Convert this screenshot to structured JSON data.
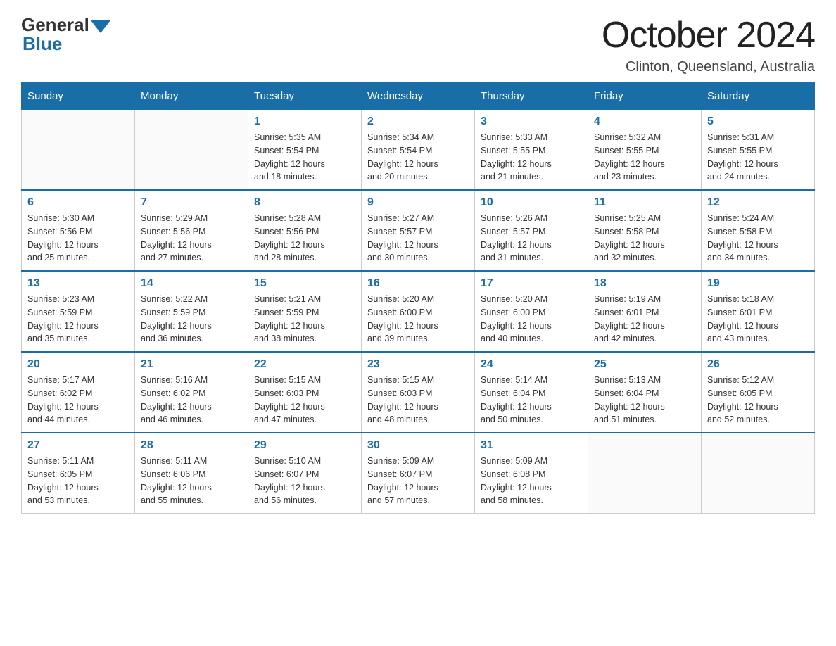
{
  "logo": {
    "general": "General",
    "blue": "Blue"
  },
  "title": "October 2024",
  "subtitle": "Clinton, Queensland, Australia",
  "days_of_week": [
    "Sunday",
    "Monday",
    "Tuesday",
    "Wednesday",
    "Thursday",
    "Friday",
    "Saturday"
  ],
  "weeks": [
    [
      {
        "day": "",
        "info": ""
      },
      {
        "day": "",
        "info": ""
      },
      {
        "day": "1",
        "info": "Sunrise: 5:35 AM\nSunset: 5:54 PM\nDaylight: 12 hours\nand 18 minutes."
      },
      {
        "day": "2",
        "info": "Sunrise: 5:34 AM\nSunset: 5:54 PM\nDaylight: 12 hours\nand 20 minutes."
      },
      {
        "day": "3",
        "info": "Sunrise: 5:33 AM\nSunset: 5:55 PM\nDaylight: 12 hours\nand 21 minutes."
      },
      {
        "day": "4",
        "info": "Sunrise: 5:32 AM\nSunset: 5:55 PM\nDaylight: 12 hours\nand 23 minutes."
      },
      {
        "day": "5",
        "info": "Sunrise: 5:31 AM\nSunset: 5:55 PM\nDaylight: 12 hours\nand 24 minutes."
      }
    ],
    [
      {
        "day": "6",
        "info": "Sunrise: 5:30 AM\nSunset: 5:56 PM\nDaylight: 12 hours\nand 25 minutes."
      },
      {
        "day": "7",
        "info": "Sunrise: 5:29 AM\nSunset: 5:56 PM\nDaylight: 12 hours\nand 27 minutes."
      },
      {
        "day": "8",
        "info": "Sunrise: 5:28 AM\nSunset: 5:56 PM\nDaylight: 12 hours\nand 28 minutes."
      },
      {
        "day": "9",
        "info": "Sunrise: 5:27 AM\nSunset: 5:57 PM\nDaylight: 12 hours\nand 30 minutes."
      },
      {
        "day": "10",
        "info": "Sunrise: 5:26 AM\nSunset: 5:57 PM\nDaylight: 12 hours\nand 31 minutes."
      },
      {
        "day": "11",
        "info": "Sunrise: 5:25 AM\nSunset: 5:58 PM\nDaylight: 12 hours\nand 32 minutes."
      },
      {
        "day": "12",
        "info": "Sunrise: 5:24 AM\nSunset: 5:58 PM\nDaylight: 12 hours\nand 34 minutes."
      }
    ],
    [
      {
        "day": "13",
        "info": "Sunrise: 5:23 AM\nSunset: 5:59 PM\nDaylight: 12 hours\nand 35 minutes."
      },
      {
        "day": "14",
        "info": "Sunrise: 5:22 AM\nSunset: 5:59 PM\nDaylight: 12 hours\nand 36 minutes."
      },
      {
        "day": "15",
        "info": "Sunrise: 5:21 AM\nSunset: 5:59 PM\nDaylight: 12 hours\nand 38 minutes."
      },
      {
        "day": "16",
        "info": "Sunrise: 5:20 AM\nSunset: 6:00 PM\nDaylight: 12 hours\nand 39 minutes."
      },
      {
        "day": "17",
        "info": "Sunrise: 5:20 AM\nSunset: 6:00 PM\nDaylight: 12 hours\nand 40 minutes."
      },
      {
        "day": "18",
        "info": "Sunrise: 5:19 AM\nSunset: 6:01 PM\nDaylight: 12 hours\nand 42 minutes."
      },
      {
        "day": "19",
        "info": "Sunrise: 5:18 AM\nSunset: 6:01 PM\nDaylight: 12 hours\nand 43 minutes."
      }
    ],
    [
      {
        "day": "20",
        "info": "Sunrise: 5:17 AM\nSunset: 6:02 PM\nDaylight: 12 hours\nand 44 minutes."
      },
      {
        "day": "21",
        "info": "Sunrise: 5:16 AM\nSunset: 6:02 PM\nDaylight: 12 hours\nand 46 minutes."
      },
      {
        "day": "22",
        "info": "Sunrise: 5:15 AM\nSunset: 6:03 PM\nDaylight: 12 hours\nand 47 minutes."
      },
      {
        "day": "23",
        "info": "Sunrise: 5:15 AM\nSunset: 6:03 PM\nDaylight: 12 hours\nand 48 minutes."
      },
      {
        "day": "24",
        "info": "Sunrise: 5:14 AM\nSunset: 6:04 PM\nDaylight: 12 hours\nand 50 minutes."
      },
      {
        "day": "25",
        "info": "Sunrise: 5:13 AM\nSunset: 6:04 PM\nDaylight: 12 hours\nand 51 minutes."
      },
      {
        "day": "26",
        "info": "Sunrise: 5:12 AM\nSunset: 6:05 PM\nDaylight: 12 hours\nand 52 minutes."
      }
    ],
    [
      {
        "day": "27",
        "info": "Sunrise: 5:11 AM\nSunset: 6:05 PM\nDaylight: 12 hours\nand 53 minutes."
      },
      {
        "day": "28",
        "info": "Sunrise: 5:11 AM\nSunset: 6:06 PM\nDaylight: 12 hours\nand 55 minutes."
      },
      {
        "day": "29",
        "info": "Sunrise: 5:10 AM\nSunset: 6:07 PM\nDaylight: 12 hours\nand 56 minutes."
      },
      {
        "day": "30",
        "info": "Sunrise: 5:09 AM\nSunset: 6:07 PM\nDaylight: 12 hours\nand 57 minutes."
      },
      {
        "day": "31",
        "info": "Sunrise: 5:09 AM\nSunset: 6:08 PM\nDaylight: 12 hours\nand 58 minutes."
      },
      {
        "day": "",
        "info": ""
      },
      {
        "day": "",
        "info": ""
      }
    ]
  ]
}
